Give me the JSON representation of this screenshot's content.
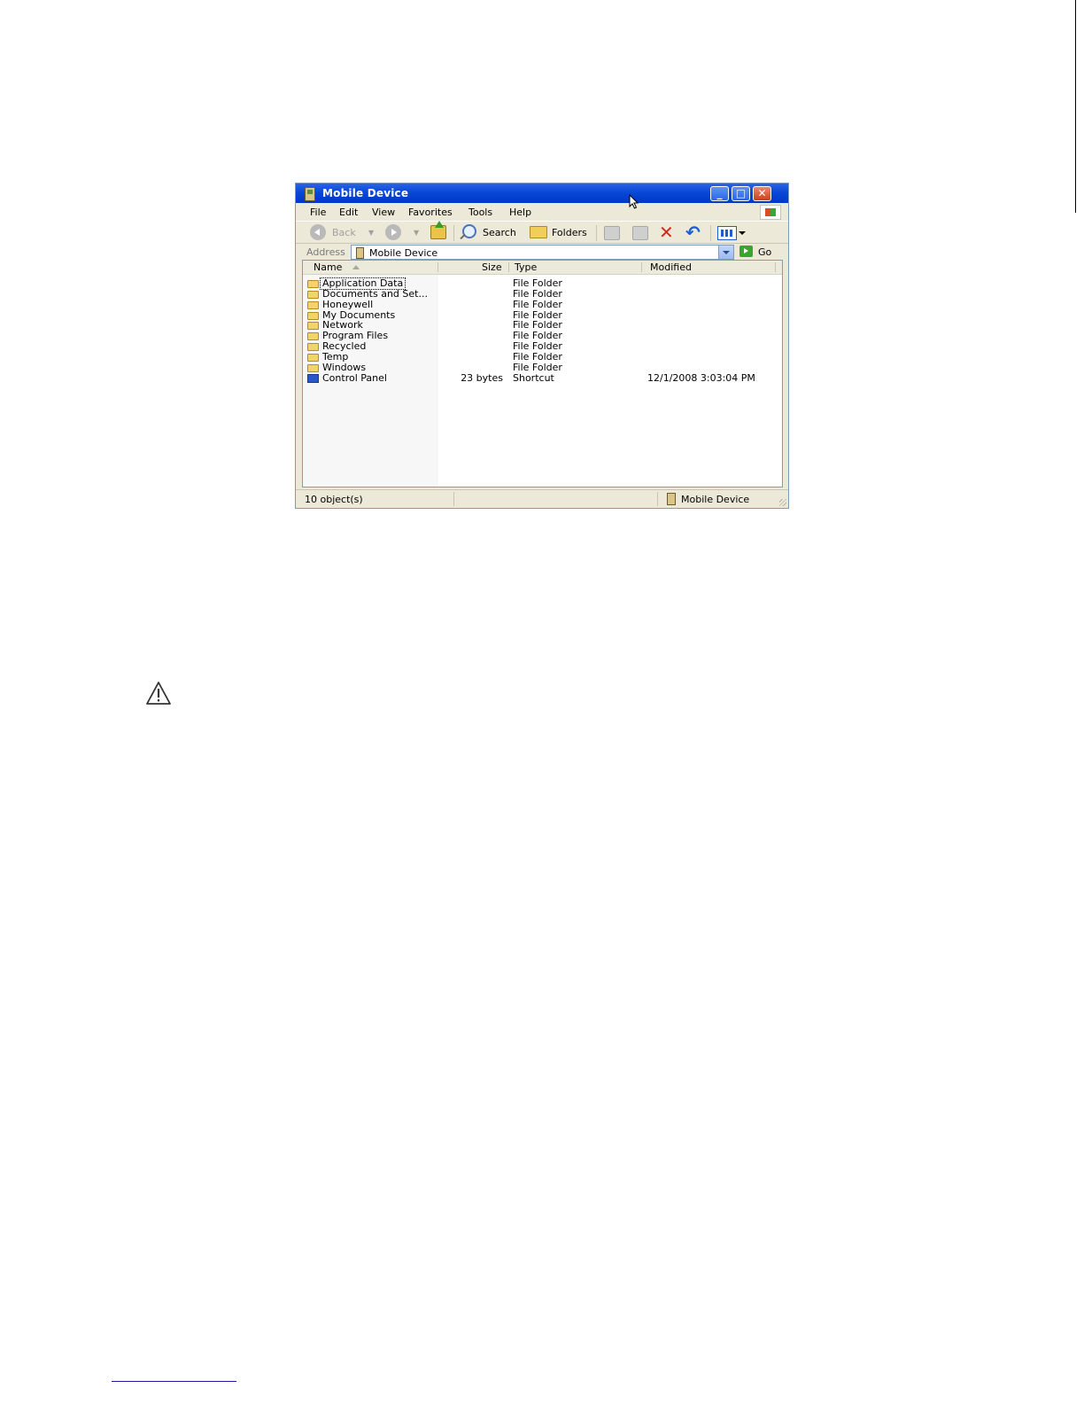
{
  "window": {
    "title": "Mobile Device",
    "controls": {
      "minimize": "_",
      "maximize": "□",
      "close": "✕"
    }
  },
  "menu": [
    "File",
    "Edit",
    "View",
    "Favorites",
    "Tools",
    "Help"
  ],
  "toolbar": {
    "back_label": "Back",
    "search_label": "Search",
    "folders_label": "Folders"
  },
  "address": {
    "label": "Address",
    "value": "Mobile Device",
    "go_label": "Go"
  },
  "columns": [
    "Name",
    "Size",
    "Type",
    "Modified"
  ],
  "files": [
    {
      "name": "Application Data",
      "size": "",
      "type": "File Folder",
      "modified": "",
      "icon": "folder-icon"
    },
    {
      "name": "Documents and Set...",
      "size": "",
      "type": "File Folder",
      "modified": "",
      "icon": "folder-icon"
    },
    {
      "name": "Honeywell",
      "size": "",
      "type": "File Folder",
      "modified": "",
      "icon": "folder-icon"
    },
    {
      "name": "My Documents",
      "size": "",
      "type": "File Folder",
      "modified": "",
      "icon": "folder-icon"
    },
    {
      "name": "Network",
      "size": "",
      "type": "File Folder",
      "modified": "",
      "icon": "folder-icon"
    },
    {
      "name": "Program Files",
      "size": "",
      "type": "File Folder",
      "modified": "",
      "icon": "folder-icon"
    },
    {
      "name": "Recycled",
      "size": "",
      "type": "File Folder",
      "modified": "",
      "icon": "folder-icon"
    },
    {
      "name": "Temp",
      "size": "",
      "type": "File Folder",
      "modified": "",
      "icon": "folder-icon"
    },
    {
      "name": "Windows",
      "size": "",
      "type": "File Folder",
      "modified": "",
      "icon": "folder-icon"
    },
    {
      "name": "Control Panel",
      "size": "23 bytes",
      "type": "Shortcut",
      "modified": "12/1/2008  3:03:04 PM",
      "icon": "shortcut-icon"
    }
  ],
  "status": {
    "count": "10 object(s)",
    "location": "Mobile Device"
  },
  "icons": {
    "warning": "warning-icon"
  }
}
